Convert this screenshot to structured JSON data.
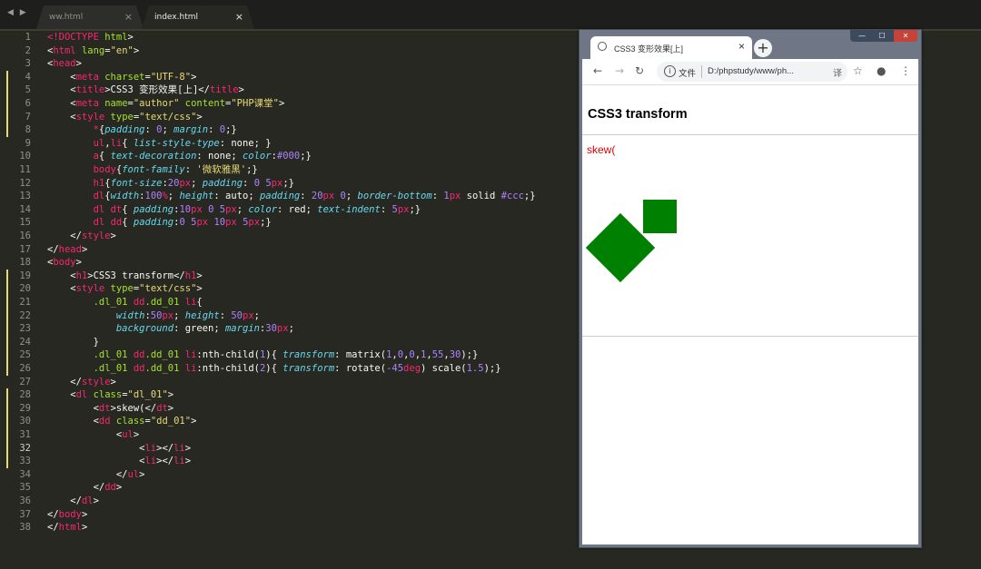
{
  "editor": {
    "nav_arrows": "◀ ▶",
    "tabs": [
      {
        "label": "ww.html",
        "close": "×"
      },
      {
        "label": "index.html",
        "close": "×"
      }
    ],
    "active_line": 32
  },
  "code": [
    {
      "n": "1",
      "h": "<span class=\"t-tag\">&lt;!DOCTYPE</span> <span class=\"t-attr\">html</span>&gt;"
    },
    {
      "n": "2",
      "h": "&lt;<span class=\"t-tag\">html</span> <span class=\"t-attr\">lang</span>=<span class=\"t-str\">\"en\"</span>&gt;"
    },
    {
      "n": "3",
      "h": "&lt;<span class=\"t-tag\">head</span>&gt;"
    },
    {
      "n": "4",
      "h": "    &lt;<span class=\"t-tag\">meta</span> <span class=\"t-attr\">charset</span>=<span class=\"t-str\">\"UTF-8\"</span>&gt;"
    },
    {
      "n": "5",
      "h": "    &lt;<span class=\"t-tag\">title</span>&gt;CSS3 变形效果[上]&lt;/<span class=\"t-tag\">title</span>&gt;"
    },
    {
      "n": "6",
      "h": "    &lt;<span class=\"t-tag\">meta</span> <span class=\"t-attr\">name</span>=<span class=\"t-str\">\"author\"</span> <span class=\"t-attr\">content</span>=<span class=\"t-str\">\"PHP课堂\"</span>&gt;"
    },
    {
      "n": "7",
      "h": "    &lt;<span class=\"t-tag\">style</span> <span class=\"t-attr\">type</span>=<span class=\"t-str\">\"text/css\"</span>&gt;"
    },
    {
      "n": "8",
      "h": "        <span class=\"t-tag\">*</span>{<span class=\"t-prop\">padding</span>: <span class=\"t-num\">0</span>; <span class=\"t-prop\">margin</span>: <span class=\"t-num\">0</span>;}"
    },
    {
      "n": "9",
      "h": "        <span class=\"t-tag\">ul</span>,<span class=\"t-tag\">li</span>{ <span class=\"t-prop\">list-style-type</span>: none; }"
    },
    {
      "n": "10",
      "h": "        <span class=\"t-tag\">a</span>{ <span class=\"t-prop\">text-decoration</span>: none; <span class=\"t-prop\">color</span>:<span class=\"t-num\">#000</span>;}"
    },
    {
      "n": "11",
      "h": "        <span class=\"t-tag\">body</span>{<span class=\"t-prop\">font-family</span>: <span class=\"t-str\">'微软雅黑'</span>;}"
    },
    {
      "n": "12",
      "h": "        <span class=\"t-tag\">h1</span>{<span class=\"t-prop\">font-size</span>:<span class=\"t-num\">20</span><span class=\"t-unit\">px</span>; <span class=\"t-prop\">padding</span>: <span class=\"t-num\">0</span> <span class=\"t-num\">5</span><span class=\"t-unit\">px</span>;}"
    },
    {
      "n": "13",
      "h": "        <span class=\"t-tag\">dl</span>{<span class=\"t-prop\">width</span>:<span class=\"t-num\">100</span><span class=\"t-unit\">%</span>; <span class=\"t-prop\">height</span>: auto; <span class=\"t-prop\">padding</span>: <span class=\"t-num\">20</span><span class=\"t-unit\">px</span> <span class=\"t-num\">0</span>; <span class=\"t-prop\">border-bottom</span>: <span class=\"t-num\">1</span><span class=\"t-unit\">px</span> solid <span class=\"t-num\">#ccc</span>;}"
    },
    {
      "n": "14",
      "h": "        <span class=\"t-tag\">dl</span> <span class=\"t-tag\">dt</span>{ <span class=\"t-prop\">padding</span>:<span class=\"t-num\">10</span><span class=\"t-unit\">px</span> <span class=\"t-num\">0</span> <span class=\"t-num\">5</span><span class=\"t-unit\">px</span>; <span class=\"t-prop\">color</span>: red; <span class=\"t-prop\">text-indent</span>: <span class=\"t-num\">5</span><span class=\"t-unit\">px</span>;}"
    },
    {
      "n": "15",
      "h": "        <span class=\"t-tag\">dl</span> <span class=\"t-tag\">dd</span>{ <span class=\"t-prop\">padding</span>:<span class=\"t-num\">0</span> <span class=\"t-num\">5</span><span class=\"t-unit\">px</span> <span class=\"t-num\">10</span><span class=\"t-unit\">px</span> <span class=\"t-num\">5</span><span class=\"t-unit\">px</span>;}"
    },
    {
      "n": "16",
      "h": "    &lt;/<span class=\"t-tag\">style</span>&gt;"
    },
    {
      "n": "17",
      "h": "&lt;/<span class=\"t-tag\">head</span>&gt;"
    },
    {
      "n": "18",
      "h": "&lt;<span class=\"t-tag\">body</span>&gt;"
    },
    {
      "n": "19",
      "h": "    &lt;<span class=\"t-tag\">h1</span>&gt;CSS3 transform&lt;/<span class=\"t-tag\">h1</span>&gt;"
    },
    {
      "n": "20",
      "h": "    &lt;<span class=\"t-tag\">style</span> <span class=\"t-attr\">type</span>=<span class=\"t-str\">\"text/css\"</span>&gt;"
    },
    {
      "n": "21",
      "h": "        <span class=\"t-sel\">.dl_01</span> <span class=\"t-tag\">dd</span><span class=\"t-sel\">.dd_01</span> <span class=\"t-tag\">li</span>{"
    },
    {
      "n": "22",
      "h": "            <span class=\"t-prop\">width</span>:<span class=\"t-num\">50</span><span class=\"t-unit\">px</span>; <span class=\"t-prop\">height</span>: <span class=\"t-num\">50</span><span class=\"t-unit\">px</span>;"
    },
    {
      "n": "23",
      "h": "            <span class=\"t-prop\">background</span>: green; <span class=\"t-prop\">margin</span>:<span class=\"t-num\">30</span><span class=\"t-unit\">px</span>;"
    },
    {
      "n": "24",
      "h": "        }"
    },
    {
      "n": "25",
      "h": "        <span class=\"t-sel\">.dl_01</span> <span class=\"t-tag\">dd</span><span class=\"t-sel\">.dd_01</span> <span class=\"t-tag\">li</span>:nth-child(<span class=\"t-num\">1</span>){ <span class=\"t-prop\">transform</span>: matrix(<span class=\"t-num\">1</span>,<span class=\"t-num\">0</span>,<span class=\"t-num\">0</span>,<span class=\"t-num\">1</span>,<span class=\"t-num\">55</span>,<span class=\"t-num\">30</span>);}"
    },
    {
      "n": "26",
      "h": "        <span class=\"t-sel\">.dl_01</span> <span class=\"t-tag\">dd</span><span class=\"t-sel\">.dd_01</span> <span class=\"t-tag\">li</span>:nth-child(<span class=\"t-num\">2</span>){ <span class=\"t-prop\">transform</span>: rotate(<span class=\"t-num\">-45</span><span class=\"t-unit\">deg</span>) scale(<span class=\"t-num\">1.5</span>);}"
    },
    {
      "n": "27",
      "h": "    &lt;/<span class=\"t-tag\">style</span>&gt;"
    },
    {
      "n": "28",
      "h": "    &lt;<span class=\"t-tag\">dl</span> <span class=\"t-attr\">class</span>=<span class=\"t-str\">\"dl_01\"</span>&gt;"
    },
    {
      "n": "29",
      "h": "        &lt;<span class=\"t-tag\">dt</span>&gt;skew(&lt;/<span class=\"t-tag\">dt</span>&gt;"
    },
    {
      "n": "30",
      "h": "        &lt;<span class=\"t-tag\">dd</span> <span class=\"t-attr\">class</span>=<span class=\"t-str\">\"dd_01\"</span>&gt;"
    },
    {
      "n": "31",
      "h": "            &lt;<span class=\"t-tag\">ul</span>&gt;"
    },
    {
      "n": "32",
      "h": "                &lt;<span class=\"t-tag\">li</span>&gt;&lt;/<span class=\"t-tag\">li</span>&gt;"
    },
    {
      "n": "33",
      "h": "                &lt;<span class=\"t-tag\">li</span>&gt;&lt;/<span class=\"t-tag\">li</span>&gt;"
    },
    {
      "n": "34",
      "h": "            &lt;/<span class=\"t-tag\">ul</span>&gt;"
    },
    {
      "n": "35",
      "h": "        &lt;/<span class=\"t-tag\">dd</span>&gt;"
    },
    {
      "n": "36",
      "h": "    &lt;/<span class=\"t-tag\">dl</span>&gt;"
    },
    {
      "n": "37",
      "h": "&lt;/<span class=\"t-tag\">body</span>&gt;"
    },
    {
      "n": "38",
      "h": "&lt;/<span class=\"t-tag\">html</span>&gt;"
    }
  ],
  "browser": {
    "window_controls": {
      "minimize": "—",
      "maximize": "☐",
      "close": "✕"
    },
    "tab_title": "CSS3 变形效果[上]",
    "tab_close": "×",
    "new_tab": "+",
    "toolbar": {
      "back": "←",
      "forward": "→",
      "reload": "↻",
      "star": "☆",
      "profile": "●",
      "menu": "⋮"
    },
    "address": {
      "info": "i",
      "security_label": "文件",
      "url": "D:/phpstudy/www/ph...",
      "translate": "译"
    },
    "page": {
      "h1": "CSS3 transform",
      "dt": "skew(",
      "squares_color": "#008000",
      "dt_color": "#e00000"
    }
  }
}
